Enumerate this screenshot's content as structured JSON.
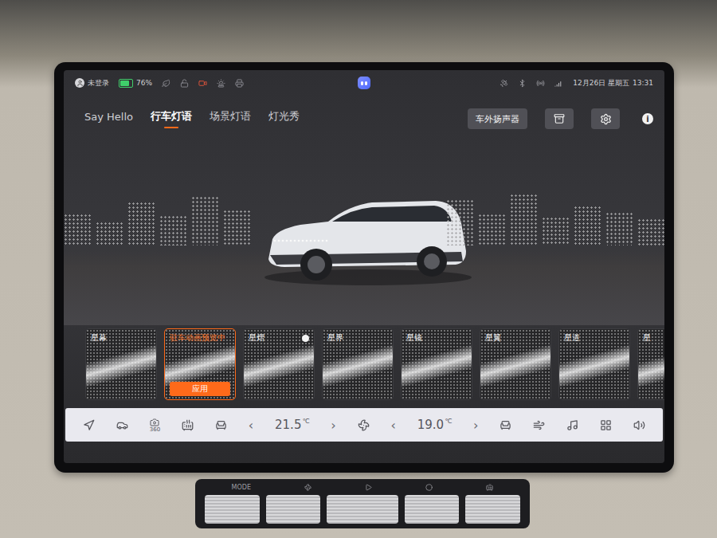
{
  "status_bar": {
    "user": "未登录",
    "battery": "76%",
    "battery_level": 0.76,
    "date": "12月26日 星期五",
    "time": "13:31"
  },
  "tabs": [
    {
      "label": "Say Hello",
      "selected": false
    },
    {
      "label": "行车灯语",
      "selected": true
    },
    {
      "label": "场景灯语",
      "selected": false
    },
    {
      "label": "灯光秀",
      "selected": false
    }
  ],
  "actions": {
    "speaker_button": "车外扬声器",
    "info": "i"
  },
  "effects": [
    {
      "name": "星幕",
      "kind": "effect",
      "selected": false,
      "marked": false
    },
    {
      "name": "驻车动画预览中",
      "kind": "preview",
      "selected": true,
      "marked": false,
      "action": "应用"
    },
    {
      "name": "星熠",
      "kind": "effect",
      "selected": false,
      "marked": true
    },
    {
      "name": "星界",
      "kind": "effect",
      "selected": false,
      "marked": false
    },
    {
      "name": "星镜",
      "kind": "effect",
      "selected": false,
      "marked": false
    },
    {
      "name": "星翼",
      "kind": "effect",
      "selected": false,
      "marked": false
    },
    {
      "name": "星道",
      "kind": "effect",
      "selected": false,
      "marked": false
    },
    {
      "name": "星",
      "kind": "effect",
      "selected": false,
      "marked": false
    }
  ],
  "climate": {
    "camera_label": "360",
    "decrease": "‹",
    "increase": "›",
    "zones": [
      {
        "temp": "21.5",
        "unit": "℃"
      },
      {
        "temp": "19.0",
        "unit": "℃"
      }
    ]
  },
  "console": {
    "mode_label": "MODE"
  }
}
